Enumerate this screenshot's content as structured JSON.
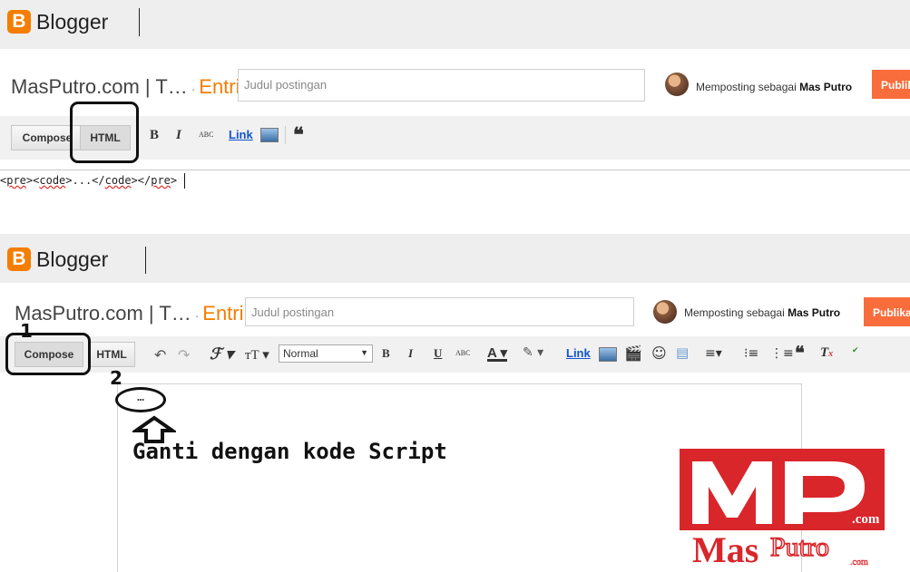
{
  "top": {
    "brand": "Blogger",
    "blog_name": "MasPutro.com | T…",
    "separator": " · ",
    "entri": "Entri",
    "title_placeholder": "Judul postingan",
    "posting_prefix": "Memposting sebagai ",
    "posting_user": "Mas Putro",
    "publish": "Publik",
    "compose": "Compose",
    "html": "HTML",
    "bold": "B",
    "italic": "I",
    "strike": "ABC",
    "link": "Link",
    "quote": "❝",
    "code": [
      {
        "text": "<",
        "u": false
      },
      {
        "text": "pre",
        "u": true
      },
      {
        "text": "><",
        "u": false
      },
      {
        "text": "code",
        "u": true
      },
      {
        "text": ">...</",
        "u": false
      },
      {
        "text": "code",
        "u": true
      },
      {
        "text": "></",
        "u": false
      },
      {
        "text": "pre",
        "u": true
      },
      {
        "text": ">",
        "u": false
      }
    ]
  },
  "bottom": {
    "brand": "Blogger",
    "blog_name": "MasPutro.com | T…",
    "separator": " · ",
    "entri": "Entri",
    "title_placeholder": "Judul postingan",
    "posting_prefix": "Memposting sebagai ",
    "posting_user": "Mas Putro",
    "publish": "Publika",
    "compose": "Compose",
    "html": "HTML",
    "font_size": "Normal",
    "bold": "B",
    "italic": "I",
    "underline": "U",
    "strike": "ABC",
    "link": "Link",
    "step1": "1",
    "step2": "2",
    "ellipsis": "…",
    "script_text": "Ganti dengan kode Script"
  },
  "watermark": {
    "initials": "MP",
    "com": ".com",
    "name_mas": "Mas",
    "name_putro": "Putro",
    "com_small": ".com",
    "color": "#d9262b"
  }
}
